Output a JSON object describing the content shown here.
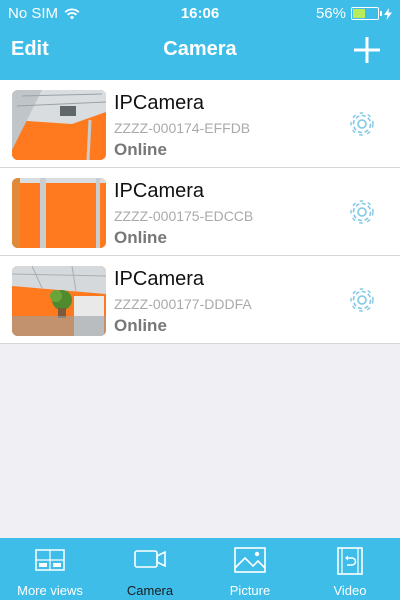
{
  "status_bar": {
    "carrier": "No SIM",
    "time": "16:06",
    "battery": "56%",
    "battery_level": 0.56
  },
  "nav": {
    "edit_label": "Edit",
    "title": "Camera"
  },
  "cameras": [
    {
      "name": "IPCamera",
      "id": "ZZZZ-000174-EFFDB",
      "status": "Online"
    },
    {
      "name": "IPCamera",
      "id": "ZZZZ-000175-EDCCB",
      "status": "Online"
    },
    {
      "name": "IPCamera",
      "id": "ZZZZ-000177-DDDFA",
      "status": "Online"
    }
  ],
  "tabbar": {
    "items": [
      {
        "label": "More views",
        "icon": "more-views-icon"
      },
      {
        "label": "Camera",
        "icon": "camera-icon"
      },
      {
        "label": "Picture",
        "icon": "picture-icon"
      },
      {
        "label": "Video",
        "icon": "video-icon"
      }
    ],
    "active": "Camera"
  },
  "colors": {
    "accent": "#3dbde8",
    "active_tab_label": "#1c1c1c"
  }
}
